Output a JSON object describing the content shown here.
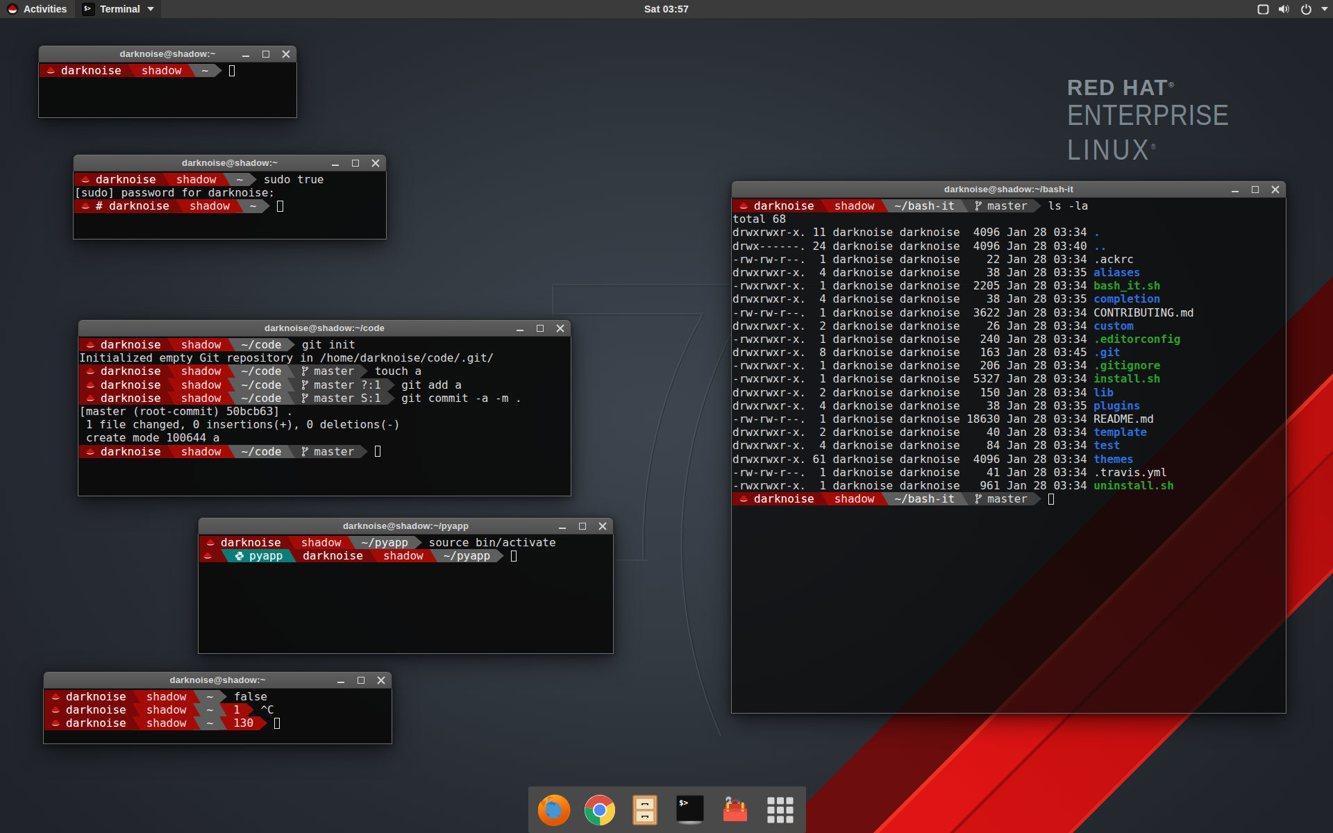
{
  "topbar": {
    "activities_label": "Activities",
    "app_label": "Terminal",
    "clock": "Sat 03:57",
    "terminal_icon_glyph": "$>",
    "status_icons": [
      "network-icon",
      "volume-icon",
      "power-icon",
      "chevron-down-icon"
    ]
  },
  "brand": {
    "line1": "RED HAT",
    "reg1": "®",
    "line2": "ENTERPRISE",
    "line3": "LINUX",
    "reg3": "®"
  },
  "colors": {
    "seg_user_bg": "#7a0806",
    "seg_user_fg": "#ffffff",
    "seg_host_bg": "#a30b07",
    "seg_host_fg": "#f0dede",
    "seg_path_bg": "#5e5e5e",
    "seg_path_fg": "#f2f2f2",
    "seg_git_bg": "#3f3f3f",
    "seg_git_fg": "#d8d8d8",
    "seg_venv_bg": "#0b7d79",
    "seg_venv_fg": "#ffffff",
    "seg_err_bg": "#a30b07",
    "seg_err_fg": "#f0dede",
    "term_text": "#dcdcdc",
    "dir_blue": "#2d6fdf",
    "exec_green": "#2aa22a",
    "accent_red": "#cc0000"
  },
  "windows": [
    {
      "id": "w1",
      "title": "darknoise@shadow:~",
      "lines": [
        {
          "type": "prompt",
          "segs": [
            {
              "kind": "user",
              "icon": "redhat-icon",
              "text": "darknoise"
            },
            {
              "kind": "host",
              "text": "shadow"
            },
            {
              "kind": "path",
              "text": "~"
            }
          ],
          "cursor": true
        }
      ]
    },
    {
      "id": "w2",
      "title": "darknoise@shadow:~",
      "lines": [
        {
          "type": "prompt",
          "segs": [
            {
              "kind": "user",
              "icon": "redhat-icon",
              "text": "darknoise"
            },
            {
              "kind": "host",
              "text": "shadow"
            },
            {
              "kind": "path",
              "text": "~"
            }
          ],
          "cmd": "sudo true"
        },
        {
          "type": "out",
          "text": "[sudo] password for darknoise:"
        },
        {
          "type": "prompt",
          "segs": [
            {
              "kind": "user",
              "icon": "redhat-icon",
              "text": "# darknoise"
            },
            {
              "kind": "host",
              "text": "shadow"
            },
            {
              "kind": "path",
              "text": "~"
            }
          ],
          "cursor": true
        }
      ]
    },
    {
      "id": "w3",
      "title": "darknoise@shadow:~/code",
      "lines": [
        {
          "type": "prompt",
          "segs": [
            {
              "kind": "user",
              "icon": "redhat-icon",
              "text": "darknoise"
            },
            {
              "kind": "host",
              "text": "shadow"
            },
            {
              "kind": "path",
              "text": "~/code"
            }
          ],
          "cmd": "git init"
        },
        {
          "type": "out",
          "text": "Initialized empty Git repository in /home/darknoise/code/.git/"
        },
        {
          "type": "prompt",
          "segs": [
            {
              "kind": "user",
              "icon": "redhat-icon",
              "text": "darknoise"
            },
            {
              "kind": "host",
              "text": "shadow"
            },
            {
              "kind": "path",
              "text": "~/code"
            },
            {
              "kind": "git",
              "icon": "git-branch-icon",
              "text": "master"
            }
          ],
          "cmd": "touch a"
        },
        {
          "type": "prompt",
          "segs": [
            {
              "kind": "user",
              "icon": "redhat-icon",
              "text": "darknoise"
            },
            {
              "kind": "host",
              "text": "shadow"
            },
            {
              "kind": "path",
              "text": "~/code"
            },
            {
              "kind": "git",
              "icon": "git-branch-icon",
              "text": "master ?:1"
            }
          ],
          "cmd": "git add a"
        },
        {
          "type": "prompt",
          "segs": [
            {
              "kind": "user",
              "icon": "redhat-icon",
              "text": "darknoise"
            },
            {
              "kind": "host",
              "text": "shadow"
            },
            {
              "kind": "path",
              "text": "~/code"
            },
            {
              "kind": "git",
              "icon": "git-branch-icon",
              "text": "master S:1"
            }
          ],
          "cmd": "git commit -a -m ."
        },
        {
          "type": "out",
          "text": "[master (root-commit) 50bcb63] ."
        },
        {
          "type": "out",
          "text": " 1 file changed, 0 insertions(+), 0 deletions(-)"
        },
        {
          "type": "out",
          "text": " create mode 100644 a"
        },
        {
          "type": "prompt",
          "segs": [
            {
              "kind": "user",
              "icon": "redhat-icon",
              "text": "darknoise"
            },
            {
              "kind": "host",
              "text": "shadow"
            },
            {
              "kind": "path",
              "text": "~/code"
            },
            {
              "kind": "git",
              "icon": "git-branch-icon",
              "text": "master"
            }
          ],
          "cursor": true
        }
      ]
    },
    {
      "id": "w4",
      "title": "darknoise@shadow:~/pyapp",
      "lines": [
        {
          "type": "prompt",
          "segs": [
            {
              "kind": "user",
              "icon": "redhat-icon",
              "text": "darknoise"
            },
            {
              "kind": "host",
              "text": "shadow"
            },
            {
              "kind": "path",
              "text": "~/pyapp"
            }
          ],
          "cmd": "source bin/activate"
        },
        {
          "type": "prompt",
          "segs": [
            {
              "kind": "user",
              "icon": "redhat-icon",
              "text": ""
            },
            {
              "kind": "venv",
              "icon": "python-icon",
              "text": "pyapp"
            },
            {
              "kind": "user",
              "text": "darknoise"
            },
            {
              "kind": "host",
              "text": "shadow"
            },
            {
              "kind": "path",
              "text": "~/pyapp"
            }
          ],
          "cursor": true
        }
      ]
    },
    {
      "id": "w5",
      "title": "darknoise@shadow:~",
      "lines": [
        {
          "type": "prompt",
          "segs": [
            {
              "kind": "user",
              "icon": "redhat-icon",
              "text": "darknoise"
            },
            {
              "kind": "host",
              "text": "shadow"
            },
            {
              "kind": "path",
              "text": "~"
            }
          ],
          "cmd": "false"
        },
        {
          "type": "prompt",
          "segs": [
            {
              "kind": "user",
              "icon": "redhat-icon",
              "text": "darknoise"
            },
            {
              "kind": "host",
              "text": "shadow"
            },
            {
              "kind": "path",
              "text": "~"
            },
            {
              "kind": "err",
              "text": "1"
            }
          ],
          "cmd": "^C"
        },
        {
          "type": "prompt",
          "segs": [
            {
              "kind": "user",
              "icon": "redhat-icon",
              "text": "darknoise"
            },
            {
              "kind": "host",
              "text": "shadow"
            },
            {
              "kind": "path",
              "text": "~"
            },
            {
              "kind": "err",
              "text": "130"
            }
          ],
          "cursor": true
        }
      ]
    },
    {
      "id": "w6",
      "title": "darknoise@shadow:~/bash-it",
      "lines": [
        {
          "type": "prompt",
          "segs": [
            {
              "kind": "user",
              "icon": "redhat-icon",
              "text": "darknoise"
            },
            {
              "kind": "host",
              "text": "shadow"
            },
            {
              "kind": "path",
              "text": "~/bash-it"
            },
            {
              "kind": "git",
              "icon": "git-branch-icon",
              "text": "master"
            }
          ],
          "cmd": "ls -la"
        },
        {
          "type": "out",
          "text": "total 68"
        },
        {
          "type": "ls",
          "perms": "drwxrwxr-x.",
          "links": "11",
          "owner": "darknoise",
          "group": "darknoise",
          "size": "4096",
          "month": "Jan",
          "day": "28",
          "time": "03:34",
          "name": ".",
          "cls": "dir"
        },
        {
          "type": "ls",
          "perms": "drwx------.",
          "links": "24",
          "owner": "darknoise",
          "group": "darknoise",
          "size": "4096",
          "month": "Jan",
          "day": "28",
          "time": "03:40",
          "name": "..",
          "cls": "dir"
        },
        {
          "type": "ls",
          "perms": "-rw-rw-r--.",
          "links": "1",
          "owner": "darknoise",
          "group": "darknoise",
          "size": "22",
          "month": "Jan",
          "day": "28",
          "time": "03:34",
          "name": ".ackrc",
          "cls": "plain"
        },
        {
          "type": "ls",
          "perms": "drwxrwxr-x.",
          "links": "4",
          "owner": "darknoise",
          "group": "darknoise",
          "size": "38",
          "month": "Jan",
          "day": "28",
          "time": "03:35",
          "name": "aliases",
          "cls": "dir"
        },
        {
          "type": "ls",
          "perms": "-rwxrwxr-x.",
          "links": "1",
          "owner": "darknoise",
          "group": "darknoise",
          "size": "2205",
          "month": "Jan",
          "day": "28",
          "time": "03:34",
          "name": "bash_it.sh",
          "cls": "exec"
        },
        {
          "type": "ls",
          "perms": "drwxrwxr-x.",
          "links": "4",
          "owner": "darknoise",
          "group": "darknoise",
          "size": "38",
          "month": "Jan",
          "day": "28",
          "time": "03:35",
          "name": "completion",
          "cls": "dir"
        },
        {
          "type": "ls",
          "perms": "-rw-rw-r--.",
          "links": "1",
          "owner": "darknoise",
          "group": "darknoise",
          "size": "3622",
          "month": "Jan",
          "day": "28",
          "time": "03:34",
          "name": "CONTRIBUTING.md",
          "cls": "plain"
        },
        {
          "type": "ls",
          "perms": "drwxrwxr-x.",
          "links": "2",
          "owner": "darknoise",
          "group": "darknoise",
          "size": "26",
          "month": "Jan",
          "day": "28",
          "time": "03:34",
          "name": "custom",
          "cls": "dir"
        },
        {
          "type": "ls",
          "perms": "-rwxrwxr-x.",
          "links": "1",
          "owner": "darknoise",
          "group": "darknoise",
          "size": "240",
          "month": "Jan",
          "day": "28",
          "time": "03:34",
          "name": ".editorconfig",
          "cls": "exec"
        },
        {
          "type": "ls",
          "perms": "drwxrwxr-x.",
          "links": "8",
          "owner": "darknoise",
          "group": "darknoise",
          "size": "163",
          "month": "Jan",
          "day": "28",
          "time": "03:45",
          "name": ".git",
          "cls": "dir"
        },
        {
          "type": "ls",
          "perms": "-rwxrwxr-x.",
          "links": "1",
          "owner": "darknoise",
          "group": "darknoise",
          "size": "206",
          "month": "Jan",
          "day": "28",
          "time": "03:34",
          "name": ".gitignore",
          "cls": "exec"
        },
        {
          "type": "ls",
          "perms": "-rwxrwxr-x.",
          "links": "1",
          "owner": "darknoise",
          "group": "darknoise",
          "size": "5327",
          "month": "Jan",
          "day": "28",
          "time": "03:34",
          "name": "install.sh",
          "cls": "exec"
        },
        {
          "type": "ls",
          "perms": "drwxrwxr-x.",
          "links": "2",
          "owner": "darknoise",
          "group": "darknoise",
          "size": "150",
          "month": "Jan",
          "day": "28",
          "time": "03:34",
          "name": "lib",
          "cls": "dir"
        },
        {
          "type": "ls",
          "perms": "drwxrwxr-x.",
          "links": "4",
          "owner": "darknoise",
          "group": "darknoise",
          "size": "38",
          "month": "Jan",
          "day": "28",
          "time": "03:35",
          "name": "plugins",
          "cls": "dir"
        },
        {
          "type": "ls",
          "perms": "-rw-rw-r--.",
          "links": "1",
          "owner": "darknoise",
          "group": "darknoise",
          "size": "18630",
          "month": "Jan",
          "day": "28",
          "time": "03:34",
          "name": "README.md",
          "cls": "plain"
        },
        {
          "type": "ls",
          "perms": "drwxrwxr-x.",
          "links": "2",
          "owner": "darknoise",
          "group": "darknoise",
          "size": "40",
          "month": "Jan",
          "day": "28",
          "time": "03:34",
          "name": "template",
          "cls": "dir"
        },
        {
          "type": "ls",
          "perms": "drwxrwxr-x.",
          "links": "4",
          "owner": "darknoise",
          "group": "darknoise",
          "size": "84",
          "month": "Jan",
          "day": "28",
          "time": "03:34",
          "name": "test",
          "cls": "dir"
        },
        {
          "type": "ls",
          "perms": "drwxrwxr-x.",
          "links": "61",
          "owner": "darknoise",
          "group": "darknoise",
          "size": "4096",
          "month": "Jan",
          "day": "28",
          "time": "03:34",
          "name": "themes",
          "cls": "dir"
        },
        {
          "type": "ls",
          "perms": "-rw-rw-r--.",
          "links": "1",
          "owner": "darknoise",
          "group": "darknoise",
          "size": "41",
          "month": "Jan",
          "day": "28",
          "time": "03:34",
          "name": ".travis.yml",
          "cls": "plain"
        },
        {
          "type": "ls",
          "perms": "-rwxrwxr-x.",
          "links": "1",
          "owner": "darknoise",
          "group": "darknoise",
          "size": "961",
          "month": "Jan",
          "day": "28",
          "time": "03:34",
          "name": "uninstall.sh",
          "cls": "exec"
        },
        {
          "type": "prompt",
          "segs": [
            {
              "kind": "user",
              "icon": "redhat-icon",
              "text": "darknoise"
            },
            {
              "kind": "host",
              "text": "shadow"
            },
            {
              "kind": "path",
              "text": "~/bash-it"
            },
            {
              "kind": "git",
              "icon": "git-branch-icon",
              "text": "master"
            }
          ],
          "cursor": true
        }
      ]
    }
  ],
  "window_buttons": [
    "minimize",
    "maximize",
    "close"
  ],
  "dock": {
    "items": [
      {
        "name": "firefox-icon"
      },
      {
        "name": "chrome-icon"
      },
      {
        "name": "files-icon"
      },
      {
        "name": "terminal-icon",
        "glyph": "$>"
      },
      {
        "name": "toolbox-icon"
      },
      {
        "name": "app-grid-icon"
      }
    ]
  }
}
